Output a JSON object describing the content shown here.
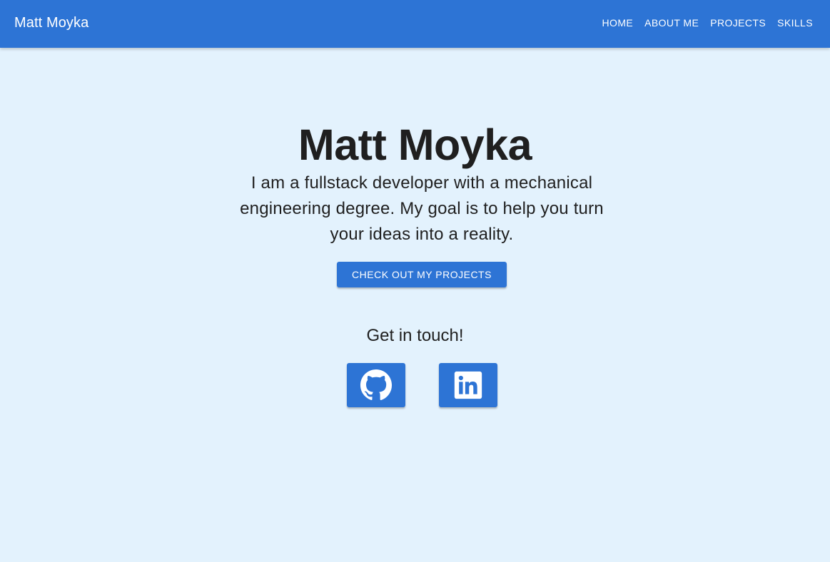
{
  "header": {
    "brand": "Matt Moyka",
    "nav": [
      {
        "label": "HOME"
      },
      {
        "label": "ABOUT ME"
      },
      {
        "label": "PROJECTS"
      },
      {
        "label": "SKILLS"
      }
    ]
  },
  "hero": {
    "title": "Matt Moyka",
    "tagline": "I am a fullstack developer with a mechanical engineering degree. My goal is to help you turn your ideas into a reality.",
    "cta_label": "CHECK OUT MY PROJECTS"
  },
  "contact": {
    "heading": "Get in touch!",
    "links": [
      {
        "icon": "github-icon"
      },
      {
        "icon": "linkedin-icon"
      }
    ]
  },
  "colors": {
    "primary": "#2d74d5",
    "background": "#e3f2fd",
    "text": "#1f1f1f"
  }
}
